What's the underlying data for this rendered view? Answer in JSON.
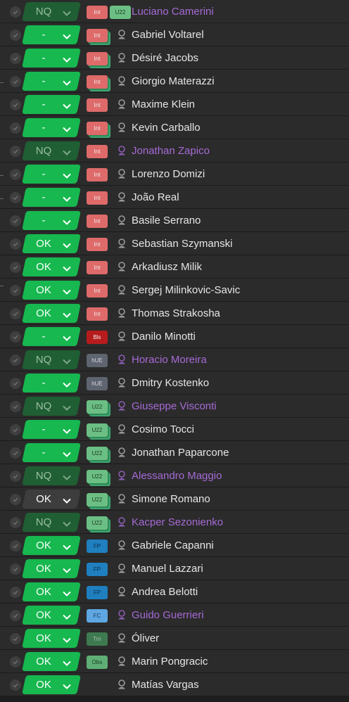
{
  "icons": {
    "check": "check-circle-icon",
    "chevron": "chevron-down-icon",
    "person": "person-icon"
  },
  "colors": {
    "status_green": "#17b84f",
    "status_nq": "#1f5f33",
    "status_ok_dark": "#3d3d3d",
    "name_white": "#e6e6e6",
    "name_purple": "#a66ad6",
    "tag_int": "#df6a6a",
    "tag_u22": "#6cbf84",
    "tag_bls": "#b71c1c",
    "tag_hue": "#5e6470",
    "tag_fp": "#1f7fbf",
    "tag_fc": "#5ea7e2",
    "tag_trn": "#3e7a4f",
    "tag_obs": "#5fae75"
  },
  "players": [
    {
      "status": "NQ",
      "name": "Luciano Camerini",
      "purple": true,
      "tags": [
        "Int",
        "U22"
      ]
    },
    {
      "status": "-",
      "name": "Gabriel Voltarel",
      "purple": false,
      "tags": [
        "Int"
      ]
    },
    {
      "status": "-",
      "name": "Désiré Jacobs",
      "purple": false,
      "tags": [
        "Int"
      ]
    },
    {
      "status": "-",
      "name": "Giorgio Materazzi",
      "purple": false,
      "tags": [
        "Int"
      ]
    },
    {
      "status": "-",
      "name": "Maxime Klein",
      "purple": false,
      "tags": [
        "Int"
      ]
    },
    {
      "status": "-",
      "name": "Kevin Carballo",
      "purple": false,
      "tags": [
        "Int"
      ]
    },
    {
      "status": "NQ",
      "name": "Jonathan Zapico",
      "purple": true,
      "tags": [
        "Int"
      ]
    },
    {
      "status": "-",
      "name": "Lorenzo Domizi",
      "purple": false,
      "tags": [
        "Int"
      ]
    },
    {
      "status": "-",
      "name": "João Real",
      "purple": false,
      "tags": [
        "Int"
      ]
    },
    {
      "status": "-",
      "name": "Basile Serrano",
      "purple": false,
      "tags": [
        "Int"
      ]
    },
    {
      "status": "OK",
      "name": "Sebastian Szymanski",
      "purple": false,
      "tags": [
        "Int"
      ]
    },
    {
      "status": "OK",
      "name": "Arkadiusz Milik",
      "purple": false,
      "tags": [
        "Int"
      ]
    },
    {
      "status": "OK",
      "name": "Sergej Milinkovic-Savic",
      "purple": false,
      "tags": [
        "Int"
      ]
    },
    {
      "status": "OK",
      "name": "Thomas Strakosha",
      "purple": false,
      "tags": [
        "Int"
      ]
    },
    {
      "status": "-",
      "name": "Danilo Minotti",
      "purple": false,
      "tags": [
        "Bls"
      ]
    },
    {
      "status": "NQ",
      "name": "Horacio Moreira",
      "purple": true,
      "tags": [
        "hUE"
      ]
    },
    {
      "status": "-",
      "name": "Dmitry Kostenko",
      "purple": false,
      "tags": [
        "hUE"
      ]
    },
    {
      "status": "NQ",
      "name": "Giuseppe Visconti",
      "purple": true,
      "tags": [
        "U22"
      ]
    },
    {
      "status": "-",
      "name": "Cosimo Tocci",
      "purple": false,
      "tags": [
        "U22"
      ]
    },
    {
      "status": "-",
      "name": "Jonathan Paparcone",
      "purple": false,
      "tags": [
        "U22"
      ]
    },
    {
      "status": "NQ",
      "name": "Alessandro Maggio",
      "purple": true,
      "tags": [
        "U22"
      ]
    },
    {
      "status": "OK",
      "name": "Simone Romano",
      "purple": false,
      "tags": [
        "U22"
      ],
      "dark": true
    },
    {
      "status": "NQ",
      "name": "Kacper Sezonienko",
      "purple": true,
      "tags": [
        "U22"
      ]
    },
    {
      "status": "OK",
      "name": "Gabriele Capanni",
      "purple": false,
      "tags": [
        "FP"
      ]
    },
    {
      "status": "OK",
      "name": "Manuel Lazzari",
      "purple": false,
      "tags": [
        "FP"
      ]
    },
    {
      "status": "OK",
      "name": "Andrea Belotti",
      "purple": false,
      "tags": [
        "FP"
      ]
    },
    {
      "status": "OK",
      "name": "Guido Guerrieri",
      "purple": true,
      "tags": [
        "FC"
      ]
    },
    {
      "status": "OK",
      "name": "Óliver",
      "purple": false,
      "tags": [
        "Trn"
      ]
    },
    {
      "status": "OK",
      "name": "Marin Pongracic",
      "purple": false,
      "tags": [
        "Obs"
      ]
    },
    {
      "status": "OK",
      "name": "Matías Vargas",
      "purple": false,
      "tags": []
    }
  ]
}
